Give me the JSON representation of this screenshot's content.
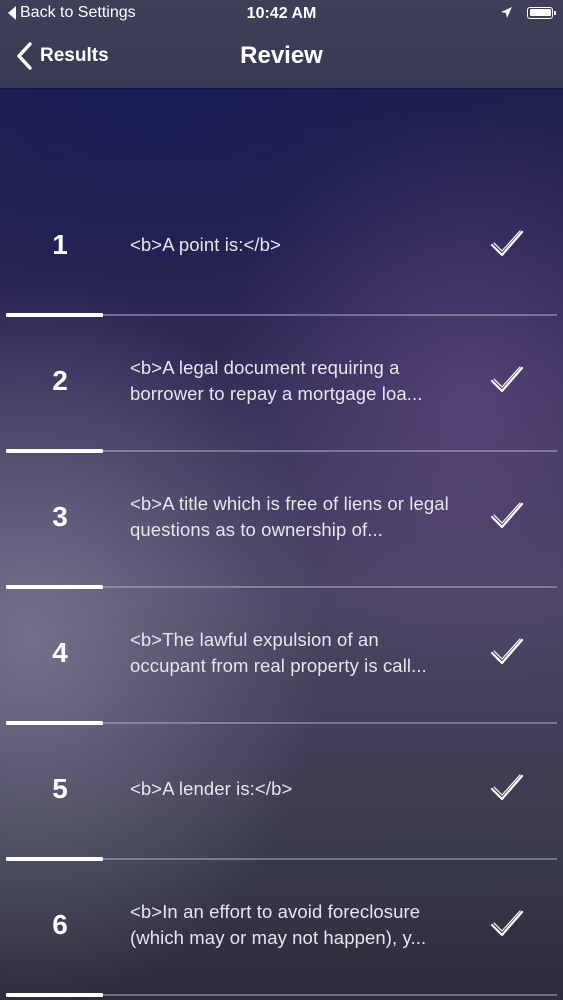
{
  "status_bar": {
    "back_app_label": "Back to Settings",
    "time": "10:42 AM"
  },
  "nav": {
    "back_label": "Results",
    "title": "Review"
  },
  "rows": [
    {
      "number": "1",
      "text": "<b>A point is:</b>"
    },
    {
      "number": "2",
      "text": "<b>A legal document requiring a borrower to repay a mortgage loa..."
    },
    {
      "number": "3",
      "text": "<b>A title which is free of liens or legal questions as to ownership of..."
    },
    {
      "number": "4",
      "text": "<b>The lawful expulsion of an occupant from real property is call..."
    },
    {
      "number": "5",
      "text": "<b>A lender is:</b>"
    },
    {
      "number": "6",
      "text": "<b>In an effort to avoid foreclosure (which may or may not happen), y..."
    }
  ],
  "icons": {
    "back_chevron": "chevron-left-icon",
    "location": "location-arrow-icon",
    "battery": "battery-icon",
    "row_status": "checkmark-icon"
  },
  "colors": {
    "nav_bar": "#3c3d56",
    "text": "#ffffff",
    "accent_line": "#ffffff"
  }
}
